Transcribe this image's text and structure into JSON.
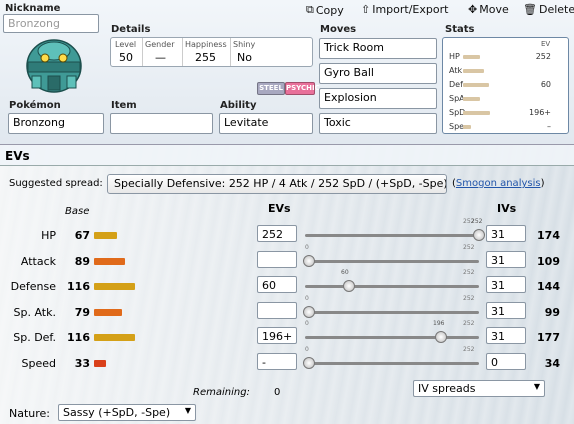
{
  "toolbar": {
    "copy": "Copy",
    "import_export": "Import/Export",
    "move": "Move",
    "delete": "Delete"
  },
  "nickname": {
    "label": "Nickname",
    "value": "Bronzong"
  },
  "details": {
    "title": "Details",
    "level_label": "Level",
    "level": "50",
    "gender_label": "Gender",
    "gender": "—",
    "happiness_label": "Happiness",
    "happiness": "255",
    "shiny_label": "Shiny",
    "shiny": "No"
  },
  "types": [
    {
      "name": "STEEL",
      "color": "#a8a8c0"
    },
    {
      "name": "PSYCHIC",
      "color": "#e8709a"
    }
  ],
  "pokemon": {
    "label": "Pokémon",
    "value": "Bronzong"
  },
  "item": {
    "label": "Item",
    "value": ""
  },
  "ability": {
    "label": "Ability",
    "value": "Levitate"
  },
  "moves": {
    "title": "Moves",
    "list": [
      "Trick Room",
      "Gyro Ball",
      "Explosion",
      "Toxic"
    ]
  },
  "stats_panel": {
    "title": "Stats",
    "ev_header": "EV",
    "rows": [
      {
        "label": "HP",
        "ev": "252",
        "fill": 0.23
      },
      {
        "label": "Atk",
        "ev": "",
        "fill": 0.28
      },
      {
        "label": "Def",
        "ev": "60",
        "fill": 0.35
      },
      {
        "label": "SpA",
        "ev": "",
        "fill": 0.23
      },
      {
        "label": "SpD",
        "ev": "196+",
        "fill": 0.36
      },
      {
        "label": "Spe",
        "ev": "–",
        "fill": 0.11
      }
    ]
  },
  "evs_section": {
    "title": "EVs"
  },
  "suggested": {
    "label": "Suggested spread:",
    "button": "Specially Defensive: 252 HP / 4 Atk / 252 SpD / (+SpD, -Spe)",
    "link": "Smogon analysis",
    "paren_open": "(",
    "paren_close": ")"
  },
  "headers": {
    "base": "Base",
    "evs": "EVs",
    "ivs": "IVs"
  },
  "slider_max": "252",
  "stats": [
    {
      "name": "HP",
      "base": "67",
      "base_fill": 0.26,
      "bar_color": "#d4a017",
      "ev": "252",
      "slider": "252",
      "slider_min": "",
      "slider_max": "252",
      "slider_frac": 1.0,
      "iv": "31",
      "total": "174"
    },
    {
      "name": "Attack",
      "base": "89",
      "base_fill": 0.35,
      "bar_color": "#e06a1a",
      "ev": "",
      "slider": "",
      "slider_min": "0",
      "slider_max": "252",
      "slider_frac": 0.0,
      "iv": "31",
      "total": "109"
    },
    {
      "name": "Defense",
      "base": "116",
      "base_fill": 0.45,
      "bar_color": "#d4a017",
      "ev": "60",
      "slider": "60",
      "slider_min": "",
      "slider_max": "252",
      "slider_frac": 0.238,
      "iv": "31",
      "total": "144"
    },
    {
      "name": "Sp. Atk.",
      "base": "79",
      "base_fill": 0.31,
      "bar_color": "#e06a1a",
      "ev": "",
      "slider": "",
      "slider_min": "0",
      "slider_max": "252",
      "slider_frac": 0.0,
      "iv": "31",
      "total": "99"
    },
    {
      "name": "Sp. Def.",
      "base": "116",
      "base_fill": 0.45,
      "bar_color": "#d4a017",
      "ev": "196+",
      "slider": "196",
      "slider_min": "0",
      "slider_max": "252",
      "slider_frac": 0.778,
      "iv": "31",
      "total": "177"
    },
    {
      "name": "Speed",
      "base": "33",
      "base_fill": 0.13,
      "bar_color": "#d9401a",
      "ev": "-",
      "slider": "",
      "slider_min": "0",
      "slider_max": "252",
      "slider_frac": 0.0,
      "iv": "0",
      "total": "34"
    }
  ],
  "remaining": {
    "label": "Remaining:",
    "value": "0"
  },
  "iv_spreads": {
    "value": "IV spreads"
  },
  "nature": {
    "label": "Nature:",
    "value": "Sassy (+SpD, -Spe)"
  }
}
